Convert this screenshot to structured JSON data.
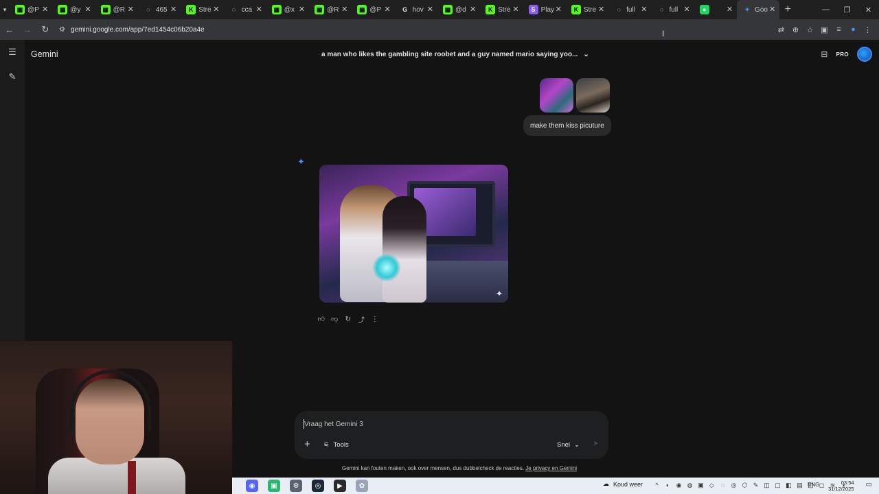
{
  "browser": {
    "tabs": [
      {
        "title": "@P",
        "favicon": "kick-green"
      },
      {
        "title": "@y",
        "favicon": "kick-green"
      },
      {
        "title": "@R",
        "favicon": "kick-green"
      },
      {
        "title": "465",
        "favicon": "globe"
      },
      {
        "title": "Stre",
        "favicon": "kick-k"
      },
      {
        "title": "cca",
        "favicon": "globe"
      },
      {
        "title": "@x",
        "favicon": "kick-green"
      },
      {
        "title": "@R",
        "favicon": "kick-green"
      },
      {
        "title": "@P",
        "favicon": "kick-green"
      },
      {
        "title": "hov",
        "favicon": "google"
      },
      {
        "title": "@d",
        "favicon": "kick-green"
      },
      {
        "title": "Stre",
        "favicon": "kick-k"
      },
      {
        "title": "Play",
        "favicon": "stake-s"
      },
      {
        "title": "Stre",
        "favicon": "kick-k"
      },
      {
        "title": "full",
        "favicon": "globe"
      },
      {
        "title": "full",
        "favicon": "globe"
      },
      {
        "title": "",
        "favicon": "spotify"
      },
      {
        "title": "Goo",
        "favicon": "gemini",
        "active": true
      }
    ],
    "url": "gemini.google.com/app/7ed1454c06b20a4e"
  },
  "app": {
    "brand": "Gemini",
    "conversation_title": "a man who likes the gambling site roobet and a guy named mario saying yoo...",
    "pro_badge": "PRO",
    "user_message": "make them kiss picuture",
    "composer_placeholder": "Vraag het Gemini 3",
    "tools_label": "Tools",
    "mode_label": "Snel",
    "disclaimer_text": "Gemini kan fouten maken, ook over mensen, dus dubbelcheck de reacties.",
    "disclaimer_link": "Je privacy en Gemini"
  },
  "taskbar": {
    "weather": "Koud weer",
    "language": "ENG",
    "time": "03:54",
    "date": "31/12/2025"
  },
  "colors": {
    "background": "#131314",
    "accent": "#4285f4",
    "bubble": "#2a2a2b"
  }
}
